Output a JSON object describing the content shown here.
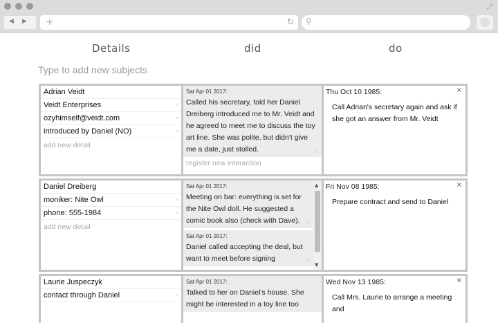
{
  "browser": {
    "nav_back": "◀",
    "nav_forward": "▶",
    "new_tab": "+",
    "reload_icon": "↻",
    "search_icon": "⚲",
    "expand_icon": "⤢"
  },
  "columns": {
    "details": "Details",
    "did": "did",
    "do": "do"
  },
  "add_subject_placeholder": "Type to add new subjects",
  "add_detail_label": "add new detail",
  "register_label": "register new interaction",
  "remove_glyph": "×",
  "subjects": [
    {
      "details": [
        "Adrian Veidt",
        "Veidt Enterprises",
        "ozyhimself@veidt.com",
        "introduced by Daniel (NO)"
      ],
      "interactions": [
        {
          "date": "Sat Apr 01 2017:",
          "text": "Called his secretary, told her Daniel Dreiberg introduced me to Mr. Veidt and he agreed to meet me to discuss the toy art line. She was polite, but didn't give me a date, just stolled."
        }
      ],
      "todo": {
        "date": "Thu Oct 10 1985:",
        "text": "Call Adrian's secretary again and ask if she got an answer from Mr. Veidt"
      }
    },
    {
      "details": [
        "Daniel Dreiberg",
        "moniker: Nite Owl",
        "phone: 555-1984"
      ],
      "interactions": [
        {
          "date": "Sat Apr 01 2017:",
          "text": "Meeting on bar: everything is set for the Nite Owl doll. He suggested a comic book also (check with Dave)."
        },
        {
          "date": "Sat Apr 01 2017:",
          "text": "Daniel called accepting the deal, but want to meet before signing"
        }
      ],
      "todo": {
        "date": "Fri Nov 08 1985:",
        "text": "Prepare contract and send to Daniel"
      }
    },
    {
      "details": [
        "Laurie Juspeczyk",
        "contact through Daniel"
      ],
      "interactions": [
        {
          "date": "Sat Apr 01 2017:",
          "text": "Talked to her on Daniel's house. She might be interested in a toy line too"
        }
      ],
      "todo": {
        "date": "Wed Nov 13 1985:",
        "text": "Call Mrs. Laurie to arrange a meeting and"
      }
    }
  ]
}
